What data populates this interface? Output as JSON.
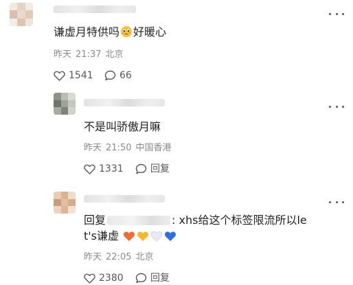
{
  "comments": [
    {
      "text_before": "谦虚月特供吗",
      "text_after": "好暖心",
      "date": "昨天",
      "time": "21:37",
      "location": "北京",
      "likes": "1541",
      "replies": "66"
    },
    {
      "text": "不是叫骄傲月嘛",
      "date": "昨天",
      "time": "21:50",
      "location": "中国香港",
      "likes": "1331",
      "reply_label": "回复"
    },
    {
      "reply_prefix": "回复",
      "line1_rest": ": xhs给这个标签限流所以le",
      "line2_text": "t's谦虚",
      "date": "昨天",
      "time": "22:05",
      "location": "北京",
      "likes": "2380",
      "reply_label": "回复"
    }
  ],
  "icons": {
    "more": "more-horizontal-icon",
    "like": "heart-outline-icon",
    "comment": "speech-bubble-icon",
    "emoji_face": "pleading-face-emoji",
    "hearts": [
      "orange-heart",
      "yellow-heart",
      "white-heart",
      "blue-heart"
    ]
  },
  "colors": {
    "text": "#222222",
    "meta": "#8a8a8a",
    "icon": "#555555",
    "orange_heart": "#f26b3a",
    "yellow_heart": "#f5b82e",
    "white_heart": "#dcd8f0",
    "blue_heart": "#2f6fe0"
  }
}
